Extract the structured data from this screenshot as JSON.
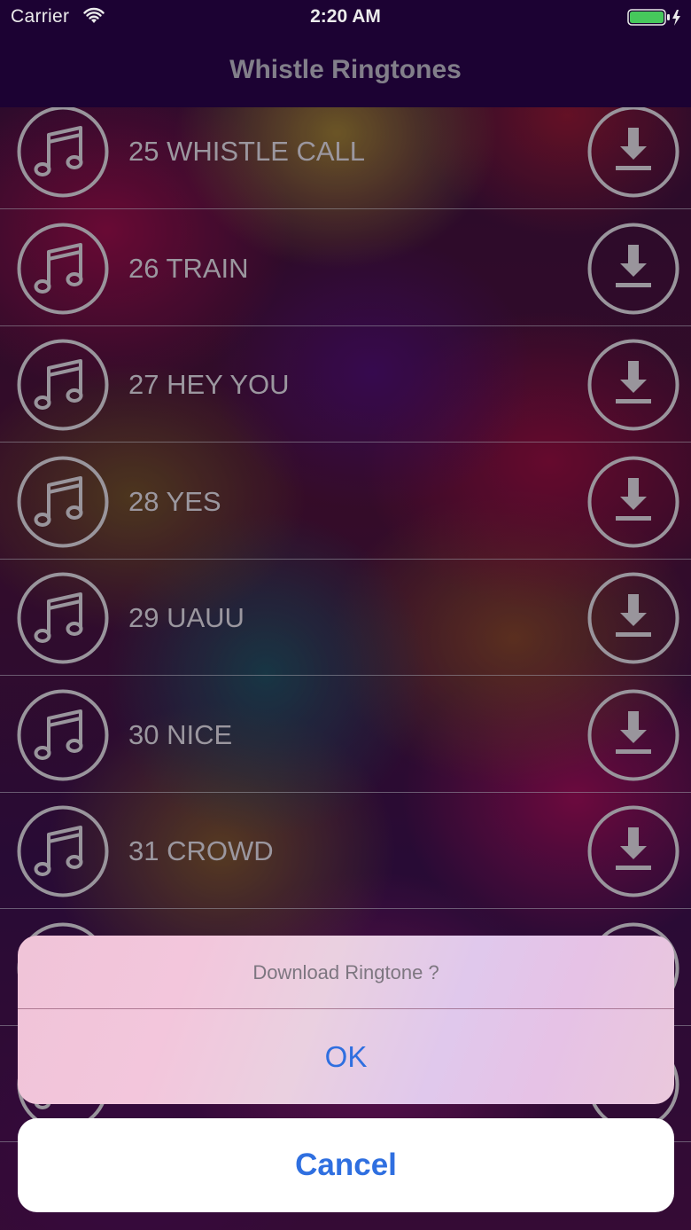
{
  "status_bar": {
    "carrier": "Carrier",
    "time": "2:20 AM",
    "wifi_icon": "wifi-icon",
    "battery_icon": "battery-charging-icon",
    "battery_color": "#4cd964"
  },
  "nav": {
    "title": "Whistle Ringtones"
  },
  "ringtones": [
    {
      "label": "25 WHISTLE CALL",
      "icon": "music-note-icon",
      "action_icon": "download-icon"
    },
    {
      "label": "26 TRAIN",
      "icon": "music-note-icon",
      "action_icon": "download-icon"
    },
    {
      "label": "27 HEY YOU",
      "icon": "music-note-icon",
      "action_icon": "download-icon"
    },
    {
      "label": "28 YES",
      "icon": "music-note-icon",
      "action_icon": "download-icon"
    },
    {
      "label": "29 UAUU",
      "icon": "music-note-icon",
      "action_icon": "download-icon"
    },
    {
      "label": "30 NICE",
      "icon": "music-note-icon",
      "action_icon": "download-icon"
    },
    {
      "label": "31 CROWD",
      "icon": "music-note-icon",
      "action_icon": "download-icon"
    },
    {
      "label": "",
      "icon": "music-note-icon",
      "action_icon": "download-icon"
    },
    {
      "label": "",
      "icon": "music-note-icon",
      "action_icon": "download-icon"
    }
  ],
  "action_sheet": {
    "title": "Download Ringtone ?",
    "ok_label": "OK",
    "cancel_label": "Cancel",
    "accent_color": "#2f6fe0"
  }
}
